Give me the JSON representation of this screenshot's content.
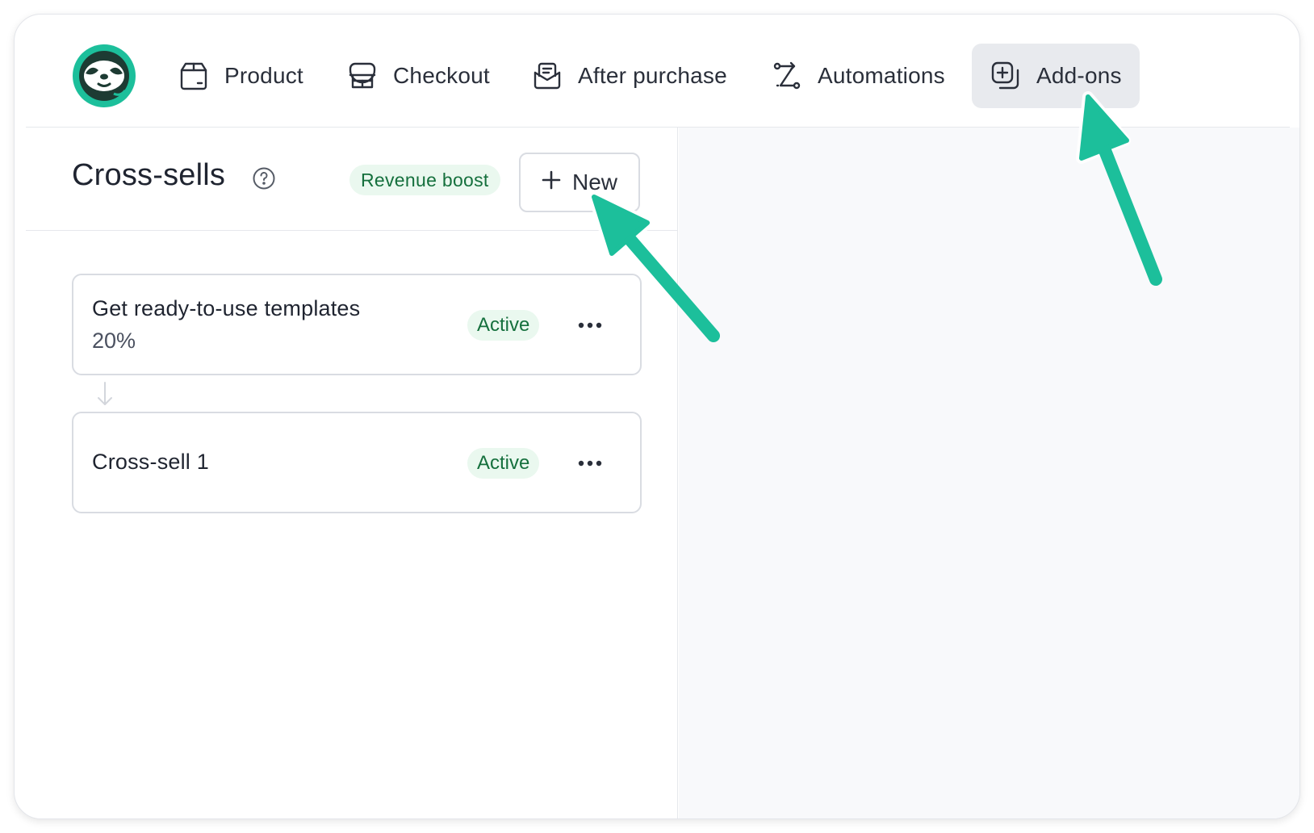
{
  "nav": {
    "logo": "sloth-logo-icon",
    "items": [
      {
        "label": "Product",
        "icon": "box-icon",
        "active": false
      },
      {
        "label": "Checkout",
        "icon": "storefront-icon",
        "active": false
      },
      {
        "label": "After purchase",
        "icon": "envelope-icon",
        "active": false
      },
      {
        "label": "Automations",
        "icon": "route-icon",
        "active": false
      },
      {
        "label": "Add-ons",
        "icon": "add-on-icon",
        "active": true
      }
    ]
  },
  "panel": {
    "title": "Cross-sells",
    "help_icon": "question-circle-icon",
    "badge": "Revenue boost",
    "new_button": "New"
  },
  "cards": [
    {
      "title": "Get ready-to-use templates",
      "subtitle": "20%",
      "status": "Active"
    },
    {
      "title": "Cross-sell 1",
      "subtitle": "",
      "status": "Active"
    }
  ],
  "colors": {
    "accent": "#1cbf9b",
    "status_green_bg": "#eaf8ef",
    "status_green_text": "#15703d",
    "active_tab_bg": "#e8eaee"
  }
}
